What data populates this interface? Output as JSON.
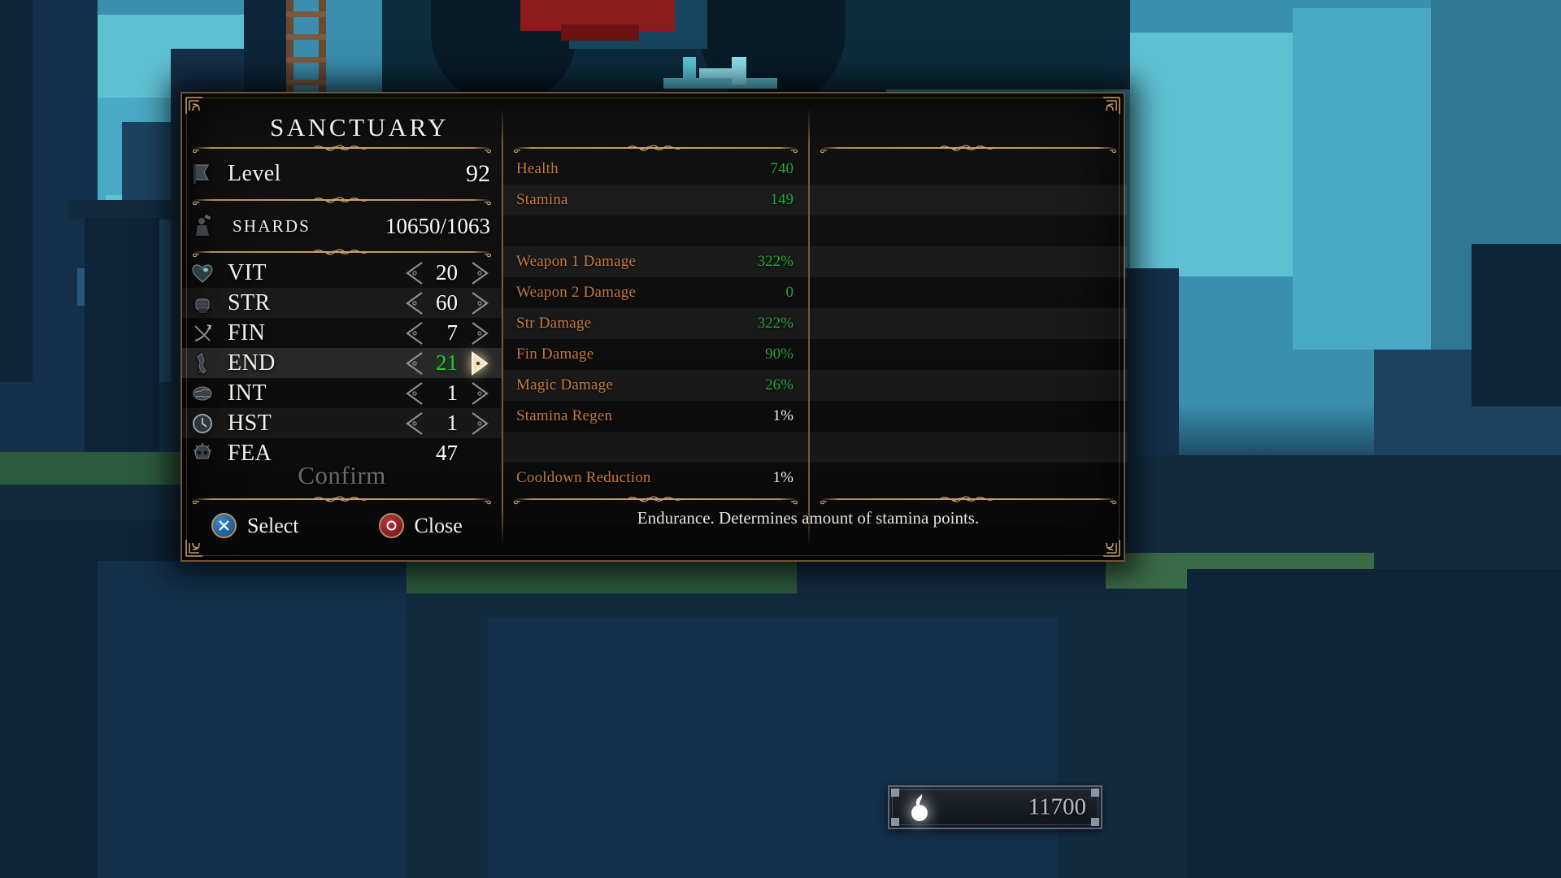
{
  "menu": {
    "title": "SANCTUARY",
    "level": {
      "label": "Level",
      "value": "92",
      "icon": "banner-icon"
    },
    "shards": {
      "label": "SHARDS",
      "value": "10650/1063",
      "icon": "blacksmith-icon"
    },
    "stats": [
      {
        "key": "vit",
        "label": "VIT",
        "value": "20",
        "icon": "heart-icon",
        "selected": false,
        "arrows": true
      },
      {
        "key": "str",
        "label": "STR",
        "value": "60",
        "icon": "fist-icon",
        "selected": false,
        "arrows": true
      },
      {
        "key": "fin",
        "label": "FIN",
        "value": "7",
        "icon": "bow-icon",
        "selected": false,
        "arrows": true
      },
      {
        "key": "end",
        "label": "END",
        "value": "21",
        "icon": "legs-icon",
        "selected": true,
        "arrows": true
      },
      {
        "key": "int",
        "label": "INT",
        "value": "1",
        "icon": "brain-icon",
        "selected": false,
        "arrows": true
      },
      {
        "key": "hst",
        "label": "HST",
        "value": "1",
        "icon": "clock-icon",
        "selected": false,
        "arrows": true
      },
      {
        "key": "fea",
        "label": "FEA",
        "value": "47",
        "icon": "skull-icon",
        "selected": false,
        "arrows": false
      }
    ],
    "confirm_label": "Confirm",
    "buttons": [
      {
        "key": "select",
        "icon": "playstation-cross-icon",
        "label": "Select",
        "color": "#2f6fb0"
      },
      {
        "key": "close",
        "icon": "playstation-circle-icon",
        "label": "Close",
        "color": "#a32a32"
      }
    ],
    "derived": [
      {
        "label": "Health",
        "value": "740",
        "tone": "green"
      },
      {
        "label": "Stamina",
        "value": "149",
        "tone": "green"
      },
      {
        "label": "",
        "value": "",
        "tone": "none"
      },
      {
        "label": "Weapon 1 Damage",
        "value": "322%",
        "tone": "green"
      },
      {
        "label": "Weapon 2 Damage",
        "value": "0",
        "tone": "green"
      },
      {
        "label": "Str Damage",
        "value": "322%",
        "tone": "green"
      },
      {
        "label": "Fin Damage",
        "value": "90%",
        "tone": "green"
      },
      {
        "label": "Magic Damage",
        "value": "26%",
        "tone": "green"
      },
      {
        "label": "Stamina Regen",
        "value": "1%",
        "tone": "white"
      },
      {
        "label": "",
        "value": "",
        "tone": "none"
      },
      {
        "label": "Cooldown Reduction",
        "value": "1%",
        "tone": "white"
      }
    ],
    "tooltip": "Endurance. Determines amount of stamina points."
  },
  "hud": {
    "souls_value": "11700",
    "souls_icon": "soul-flame-icon"
  },
  "colors": {
    "gold_border": "#6d5336",
    "gold_ornament": "#c9a06c",
    "label_orange": "#c47a3c",
    "value_green": "#26a734",
    "value_white": "#f2efe8",
    "selected_green": "#2fc43c",
    "panel_bg": "#0a0a0a"
  }
}
